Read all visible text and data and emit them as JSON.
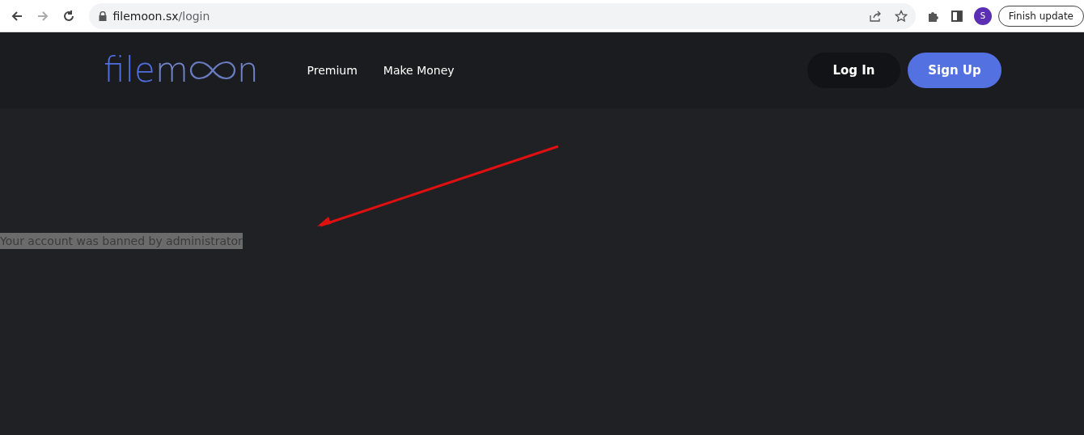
{
  "browser": {
    "url_host": "filemoon.sx",
    "url_path": "/login",
    "profile_initial": "S",
    "update_button": "Finish update"
  },
  "header": {
    "logo": {
      "part_1": "file",
      "part_2": "m",
      "part_3": "n"
    },
    "nav": [
      "Premium",
      "Make Money"
    ],
    "login_button": "Log In",
    "signup_button": "Sign Up"
  },
  "message": {
    "text": "Your account was banned by administrator",
    "highlighted": true
  }
}
